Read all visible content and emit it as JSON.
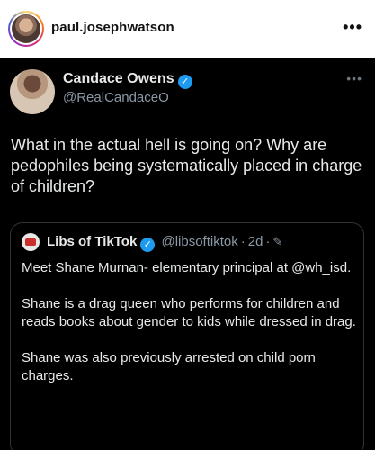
{
  "instagram": {
    "username": "paul.josephwatson",
    "more_icon": "more-horizontal-icon",
    "more_label": "•••"
  },
  "tweet": {
    "author_name": "Candace Owens",
    "author_handle": "@RealCandaceO",
    "verified_icon": "verified-badge-icon",
    "verified_glyph": "✓",
    "more_label": "•••",
    "text": "What in the actual hell is going on? Why are pedophiles being systematically placed in charge of children?"
  },
  "quote": {
    "author_name": "Libs of TikTok",
    "verified_glyph": "✓",
    "author_handle": "@libsoftiktok",
    "separator": "·",
    "time": "2d",
    "separator2": "·",
    "edit_icon": "pencil-edit-icon",
    "edit_glyph": "✎",
    "paragraphs": [
      "Meet Shane Murnan- elementary principal at @wh_isd.",
      "Shane is a drag queen who performs for children and reads books about gender to kids while dressed in drag.",
      "Shane was also previously arrested on child porn charges."
    ]
  },
  "colors": {
    "tweet_bg": "#000000",
    "text_primary": "#e7e9ea",
    "text_secondary": "#8b98a5",
    "verified_blue": "#1d9bf0",
    "border": "#2f3336"
  }
}
